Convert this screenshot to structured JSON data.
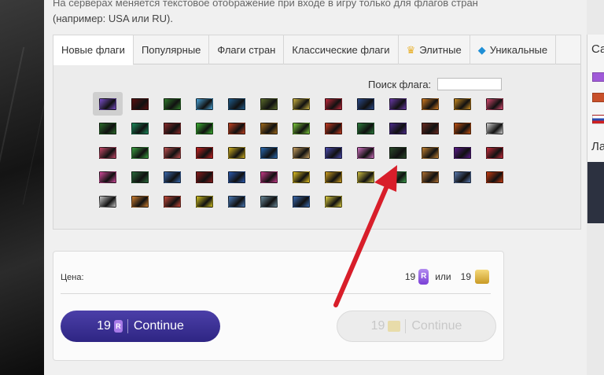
{
  "hint": {
    "line1": "На серверах меняется текстовое отображение при входе в игру только для флагов стран",
    "line2": "(например: USA или RU)."
  },
  "tabs": [
    {
      "label": "Новые флаги",
      "icon": "",
      "active": true
    },
    {
      "label": "Популярные",
      "icon": "",
      "active": false
    },
    {
      "label": "Флаги стран",
      "icon": "",
      "active": false
    },
    {
      "label": "Классические флаги",
      "icon": "",
      "active": false
    },
    {
      "label": "Элитные",
      "icon": "crown-icon",
      "active": false
    },
    {
      "label": "Уникальные",
      "icon": "diamond-icon",
      "active": false
    }
  ],
  "search": {
    "label": "Поиск флага:",
    "value": "",
    "placeholder": ""
  },
  "flags": {
    "rows": [
      [
        "#7a4fc9",
        "#5a1010",
        "#2f7a2a",
        "#4aa3d8",
        "#1f5c8c",
        "#5a6b2a",
        "#c8b040",
        "#c0283a",
        "#2a4a8a",
        "#6a3aa8",
        "#d07a20",
        "#c88a20",
        "#d84a70"
      ],
      [
        "#2a6a2a",
        "#1a8a5a",
        "#8a2a2a",
        "#3ab030",
        "#c04020",
        "#a06a1a",
        "#7ac83a",
        "#c83a20",
        "#2a7a3a",
        "#4a2a8a",
        "#6a2a20",
        "#c05010",
        "#d0d0d0"
      ],
      [
        "#c84a6a",
        "#3aa040",
        "#c05050",
        "#c82020",
        "#d0b020",
        "#2a6ab0",
        "#c8a060",
        "#4a4ab0",
        "#d070c0",
        "#2a4a2a",
        "#c08030",
        "#5a1a8a",
        "#c82a3a"
      ],
      [
        "#d04a9a",
        "#2a6a3a",
        "#3a6ab0",
        "#8a1a1a",
        "#2a5ab0",
        "#c83a8a",
        "#e0c020",
        "#d0a020",
        "#d0c040",
        "#3a9a4a",
        "#b07030",
        "#5a7ab0",
        "#c83a10"
      ],
      [
        "#c8c8c8",
        "#d08030",
        "#c84a3a",
        "#d0c020",
        "#4a7ab8",
        "#6a8a9a",
        "#3a6ab0",
        "#e0d040"
      ]
    ],
    "selected": {
      "row": 0,
      "col": 0
    }
  },
  "price": {
    "label": "Цена:",
    "rubies": "19",
    "or": "или",
    "gold": "19"
  },
  "buttons": {
    "primary": {
      "amount": "19",
      "currency_icon": "ruby-icon",
      "label": "Continue"
    },
    "secondary": {
      "amount": "19",
      "currency_icon": "gold-icon",
      "label": "Continue"
    }
  },
  "rightpanel": {
    "head1": "Са",
    "head2": "Ла"
  },
  "colors": {
    "primary_button": "#3a2f96",
    "arrow": "#d81e2a",
    "ruby": "#8a4fe0",
    "gold": "#d6a83a"
  }
}
